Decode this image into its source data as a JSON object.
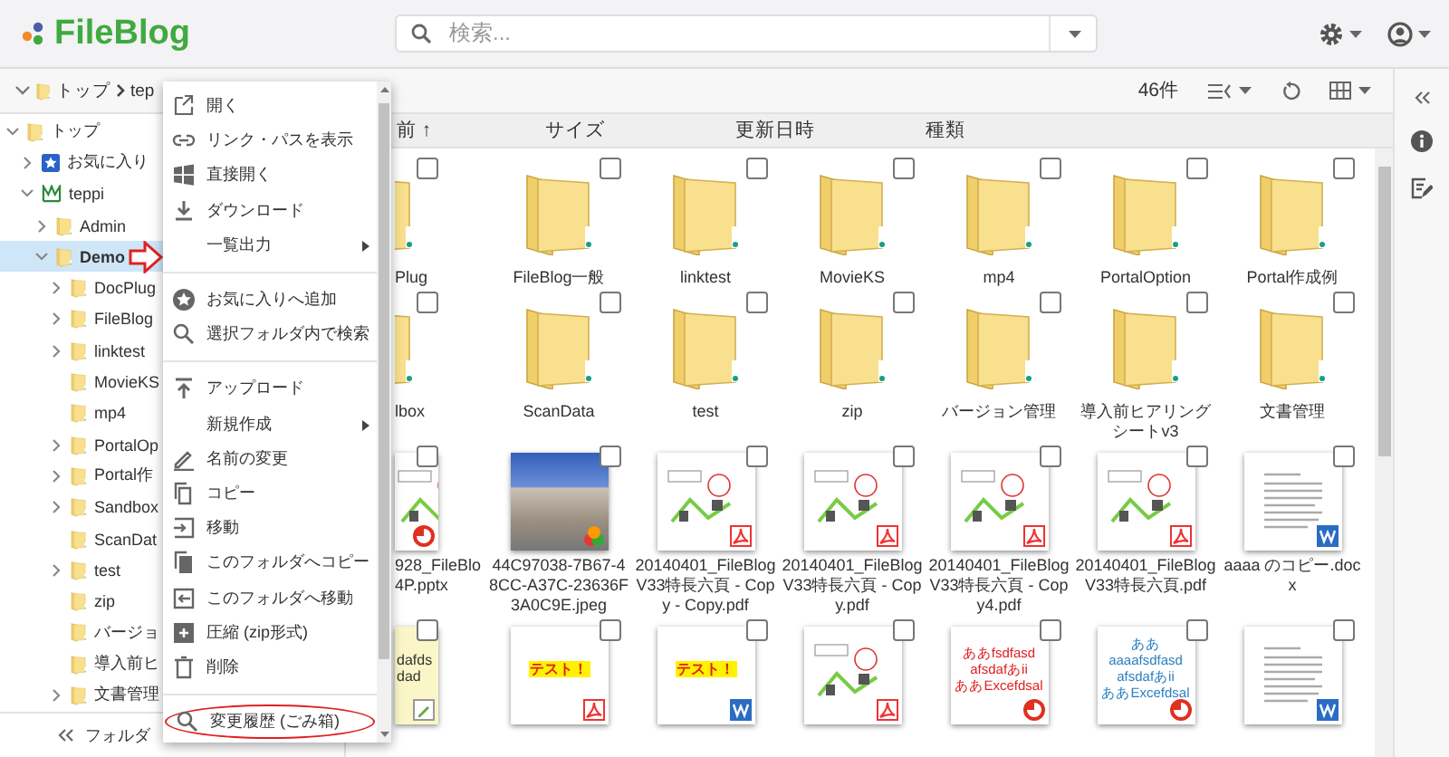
{
  "app": {
    "name": "FileBlog"
  },
  "search": {
    "placeholder": "検索..."
  },
  "breadcrumb": [
    "トップ",
    "tep"
  ],
  "toolbar": {
    "count": "46件"
  },
  "columns": [
    {
      "label": "前 ↑"
    },
    {
      "label": "サイズ"
    },
    {
      "label": "更新日時"
    },
    {
      "label": "種類"
    }
  ],
  "tree": [
    {
      "label": "トップ",
      "kind": "folder",
      "expanded": true,
      "selected": false,
      "children": [
        {
          "label": "お気に入り",
          "kind": "favorites",
          "expanded": false,
          "selected": false
        },
        {
          "label": "teppi",
          "kind": "user",
          "expanded": true,
          "selected": false,
          "children": [
            {
              "label": "Admin",
              "kind": "folder",
              "expanded": false,
              "selected": false
            },
            {
              "label": "Demo",
              "kind": "folder",
              "expanded": true,
              "selected": true,
              "pointed": true,
              "children": [
                {
                  "label": "DocPlug",
                  "kind": "folder",
                  "expanded": false,
                  "selected": false
                },
                {
                  "label": "FileBlog",
                  "kind": "folder",
                  "expanded": false,
                  "selected": false
                },
                {
                  "label": "linktest",
                  "kind": "folder",
                  "expanded": false,
                  "selected": false
                },
                {
                  "label": "MovieKS",
                  "kind": "folder",
                  "selected": false
                },
                {
                  "label": "mp4",
                  "kind": "folder",
                  "selected": false
                },
                {
                  "label": "PortalOp",
                  "kind": "folder",
                  "expanded": false,
                  "selected": false
                },
                {
                  "label": "Portal作",
                  "kind": "folder",
                  "expanded": false,
                  "selected": false
                },
                {
                  "label": "Sandbox",
                  "kind": "folder",
                  "expanded": false,
                  "selected": false
                },
                {
                  "label": "ScanDat",
                  "kind": "folder",
                  "selected": false
                },
                {
                  "label": "test",
                  "kind": "folder",
                  "expanded": false,
                  "selected": false
                },
                {
                  "label": "zip",
                  "kind": "folder",
                  "selected": false
                },
                {
                  "label": "バージョ",
                  "kind": "folder",
                  "selected": false
                },
                {
                  "label": "導入前ヒ",
                  "kind": "folder",
                  "selected": false
                },
                {
                  "label": "文書管理",
                  "kind": "folder",
                  "expanded": false,
                  "selected": false
                }
              ]
            }
          ]
        }
      ]
    }
  ],
  "sidebar_footer": {
    "label": "フォルダ"
  },
  "menu": {
    "items": [
      {
        "kind": "open",
        "label": "開く",
        "submenu": false
      },
      {
        "kind": "link",
        "label": "リンク・パスを表示",
        "submenu": false
      },
      {
        "kind": "windows",
        "label": "直接開く",
        "submenu": false
      },
      {
        "kind": "download",
        "label": "ダウンロード",
        "submenu": false
      },
      {
        "kind": "plain",
        "label": "一覧出力",
        "submenu": true
      },
      {
        "kind": "divider"
      },
      {
        "kind": "favorite",
        "label": "お気に入りへ追加",
        "submenu": false
      },
      {
        "kind": "search",
        "label": "選択フォルダ内で検索",
        "submenu": false
      },
      {
        "kind": "divider"
      },
      {
        "kind": "upload",
        "label": "アップロード",
        "submenu": false
      },
      {
        "kind": "plain",
        "label": "新規作成",
        "submenu": true
      },
      {
        "kind": "rename",
        "label": "名前の変更",
        "submenu": false
      },
      {
        "kind": "copy",
        "label": "コピー",
        "submenu": false
      },
      {
        "kind": "move",
        "label": "移動",
        "submenu": false
      },
      {
        "kind": "copyto",
        "label": "このフォルダへコピー",
        "submenu": false
      },
      {
        "kind": "moveto",
        "label": "このフォルダへ移動",
        "submenu": false
      },
      {
        "kind": "zip",
        "label": "圧縮 (zip形式)",
        "submenu": false
      },
      {
        "kind": "delete",
        "label": "削除",
        "submenu": false
      },
      {
        "kind": "divider"
      },
      {
        "kind": "history",
        "label": "変更履歴 (ごみ箱)",
        "submenu": false,
        "circled": true
      }
    ]
  },
  "grid": {
    "rows": [
      {
        "tiles": [
          {
            "kind": "folder",
            "label": "Plug",
            "checked": false
          },
          {
            "kind": "folder",
            "label": "FileBlog一般",
            "checked": false
          },
          {
            "kind": "folder",
            "label": "linktest",
            "checked": false
          },
          {
            "kind": "folder",
            "label": "MovieKS",
            "checked": false
          },
          {
            "kind": "folder",
            "label": "mp4",
            "checked": false
          },
          {
            "kind": "folder",
            "label": "PortalOption",
            "checked": false
          },
          {
            "kind": "folder",
            "label": "Portal作成例",
            "checked": false
          }
        ]
      },
      {
        "tiles": [
          {
            "kind": "folder",
            "label": "lbox",
            "checked": false
          },
          {
            "kind": "folder",
            "label": "ScanData",
            "checked": false
          },
          {
            "kind": "folder",
            "label": "test",
            "checked": false
          },
          {
            "kind": "folder",
            "label": "zip",
            "checked": false
          },
          {
            "kind": "folder",
            "label": "バージョン管理",
            "checked": false
          },
          {
            "kind": "folder",
            "label": "導入前ヒアリングシートv3",
            "checked": false
          },
          {
            "kind": "folder",
            "label": "文書管理",
            "checked": false
          }
        ]
      },
      {
        "tiles": [
          {
            "kind": "pptx",
            "label": "928_FileBlo 4P.pptx",
            "checked": false
          },
          {
            "kind": "jpeg",
            "label": "44C97038-7B67-48CC-A37C-23636F3A0C9E.jpeg",
            "checked": false
          },
          {
            "kind": "pdf",
            "label": "20140401_FileBlogV33特長六頁 - Copy - Copy.pdf",
            "checked": false
          },
          {
            "kind": "pdf",
            "label": "20140401_FileBlogV33特長六頁 - Copy.pdf",
            "checked": false
          },
          {
            "kind": "pdf",
            "label": "20140401_FileBlogV33特長六頁 - Copy4.pdf",
            "checked": false
          },
          {
            "kind": "pdf",
            "label": "20140401_FileBlogV33特長六頁.pdf",
            "checked": false
          },
          {
            "kind": "docx",
            "label": "aaaa のコピー.docx",
            "checked": false
          }
        ]
      },
      {
        "tiles": [
          {
            "kind": "note",
            "lines": [
              "dafds",
              "dad"
            ],
            "highlighted": false,
            "checked": false
          },
          {
            "kind": "pdf",
            "lines": [
              "テスト！"
            ],
            "highlighted": true,
            "checked": false
          },
          {
            "kind": "docx",
            "lines": [
              "テスト！"
            ],
            "highlighted": true,
            "checked": false
          },
          {
            "kind": "pdf",
            "checked": false
          },
          {
            "kind": "pptx",
            "lines": [
              "ああfsdfasd",
              "afsdafあii",
              "ああExcefdsal"
            ],
            "highlighted": false,
            "color": "#e02020",
            "checked": false
          },
          {
            "kind": "pptx",
            "lines": [
              "ああ",
              "aaaafsdfasd",
              "afsdafあii",
              "ああExcefdsal"
            ],
            "highlighted": false,
            "color": "#2a7fc0",
            "checked": false
          },
          {
            "kind": "docx",
            "checked": false
          }
        ]
      }
    ]
  }
}
